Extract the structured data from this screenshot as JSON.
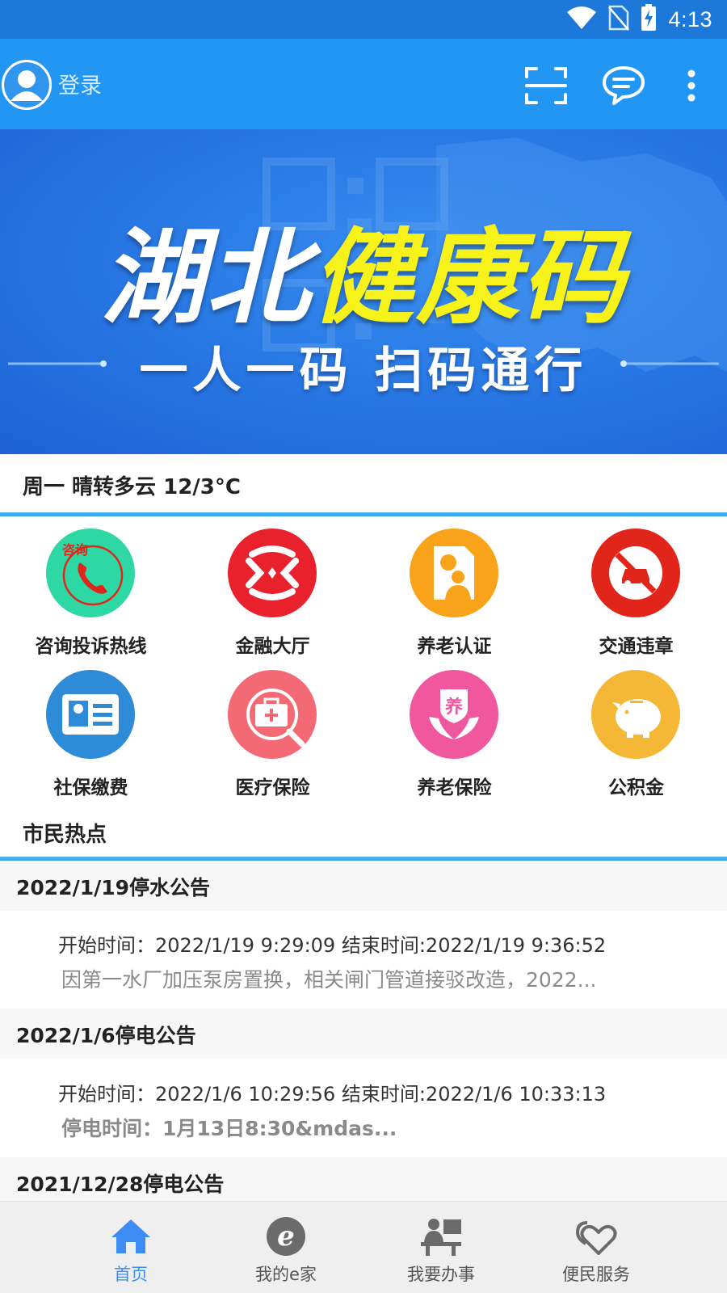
{
  "status_bar": {
    "time": "4:13"
  },
  "header": {
    "login_label": "登录"
  },
  "banner": {
    "title_white": "湖北",
    "title_yellow": "健康码",
    "subtitle": "一人一码  扫码通行"
  },
  "weather": {
    "text": "周一 晴转多云 12/3°C"
  },
  "services": [
    {
      "label": "咨询投诉热线",
      "icon": "phone-consult-icon",
      "color": "#2ed8a4",
      "badge": "咨询"
    },
    {
      "label": "金融大厅",
      "icon": "finance-icon",
      "color": "#e8212d"
    },
    {
      "label": "养老认证",
      "icon": "certificate-icon",
      "color": "#f9a31b"
    },
    {
      "label": "交通违章",
      "icon": "no-car-icon",
      "color": "#e1251b"
    },
    {
      "label": "社保缴费",
      "icon": "id-card-icon",
      "color": "#2e8bd8"
    },
    {
      "label": "医疗保险",
      "icon": "medical-kit-icon",
      "color": "#f46a74"
    },
    {
      "label": "养老保险",
      "icon": "care-hands-icon",
      "color": "#f0579e",
      "badge": "养"
    },
    {
      "label": "公积金",
      "icon": "piggy-bank-icon",
      "color": "#f5b836"
    }
  ],
  "news": {
    "section_title": "市民热点",
    "items": [
      {
        "title": "2022/1/19停水公告",
        "time": "开始时间：2022/1/19 9:29:09 结束时间:2022/1/19 9:36:52",
        "desc": "因第一水厂加压泵房置换，相关闸门管道接驳改造，2022..."
      },
      {
        "title": "2022/1/6停电公告",
        "time": "开始时间：2022/1/6 10:29:56 结束时间:2022/1/6 10:33:13",
        "desc": "停电时间：1月13日8:30&mdas..."
      },
      {
        "title": "2021/12/28停电公告"
      }
    ]
  },
  "bottom_nav": [
    {
      "label": "首页",
      "icon": "home-icon",
      "active": true
    },
    {
      "label": "我的e家",
      "icon": "e-home-icon"
    },
    {
      "label": "我要办事",
      "icon": "office-worker-icon"
    },
    {
      "label": "便民服务",
      "icon": "heart-service-icon"
    }
  ],
  "colors": {
    "status_bar": "#1d79d9",
    "header": "#2196f3",
    "accent": "#3d8df5",
    "divider": "#35a7ee"
  }
}
